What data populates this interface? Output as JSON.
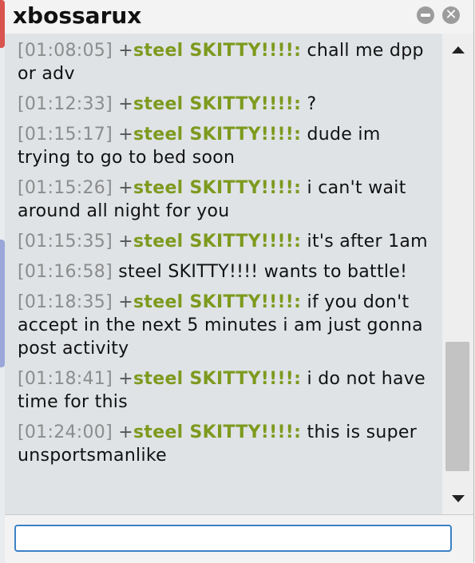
{
  "window": {
    "title": "xbossarux"
  },
  "messages": [
    {
      "time": "[01:08:05]",
      "prefix": " +",
      "user": "steel SKITTY!!!!:",
      "text": " chall me dpp or adv"
    },
    {
      "time": "[01:12:33]",
      "prefix": " +",
      "user": "steel SKITTY!!!!:",
      "text": " ?"
    },
    {
      "time": "[01:15:17]",
      "prefix": " +",
      "user": "steel SKITTY!!!!:",
      "text": " dude im trying to go to bed soon"
    },
    {
      "time": "[01:15:26]",
      "prefix": " +",
      "user": "steel SKITTY!!!!:",
      "text": " i can't wait around all night for you"
    },
    {
      "time": "[01:15:35]",
      "prefix": " +",
      "user": "steel SKITTY!!!!:",
      "text": " it's after 1am"
    },
    {
      "time": "[01:16:58]",
      "system": " steel SKITTY!!!! wants to battle!"
    },
    {
      "time": "[01:18:35]",
      "prefix": " +",
      "user": "steel SKITTY!!!!:",
      "text": " if you don't accept in the next 5 minutes i am just gonna post activity"
    },
    {
      "time": "[01:18:41]",
      "prefix": " +",
      "user": "steel SKITTY!!!!:",
      "text": " i do not have time for this"
    },
    {
      "time": "[01:24:00]",
      "prefix": " +",
      "user": "steel SKITTY!!!!:",
      "text": " this is super unsportsmanlike"
    }
  ],
  "composer": {
    "value": "",
    "placeholder": ""
  },
  "colors": {
    "username": "#7d9a1e",
    "timestamp": "#8c8c8c",
    "log_bg": "#dfe3e6",
    "input_border": "#3b82c6"
  },
  "icons": {
    "minimize": "minimize-icon",
    "close": "close-icon",
    "scroll_up": "arrow-up-icon",
    "scroll_down": "arrow-down-icon"
  }
}
